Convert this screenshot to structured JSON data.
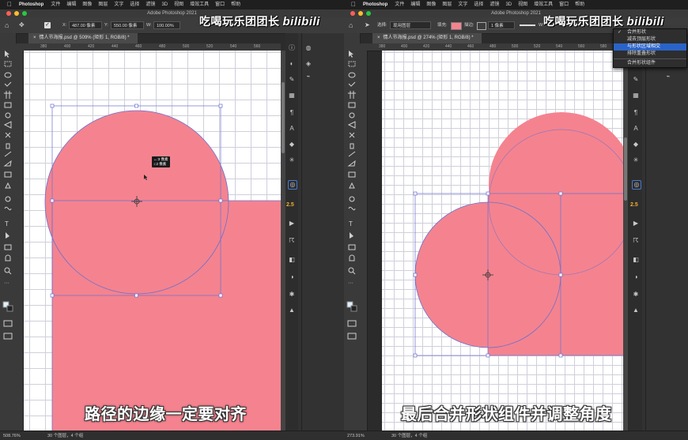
{
  "menubar": {
    "app": "Photoshop",
    "items": [
      "文件",
      "编辑",
      "图像",
      "图层",
      "文字",
      "选择",
      "滤镜",
      "3D",
      "视图",
      "增效工具",
      "窗口",
      "帮助"
    ]
  },
  "window_title": "Adobe Photoshop 2021",
  "watermark": {
    "text": "吃喝玩乐团团长",
    "brand": "bilibili"
  },
  "left": {
    "options": {
      "x_label": "X:",
      "x_value": "487.00 像素",
      "y_label": "Y:",
      "y_value": "550.00 像素",
      "w_label": "W:",
      "w_value": "100.00%"
    },
    "doc_tab": "情人节海报.psd @ 509% (矩形 1, RGB/8) *",
    "ruler_labels": [
      "380",
      "400",
      "420",
      "440",
      "460",
      "480",
      "500",
      "520",
      "540",
      "560"
    ],
    "tooltip": [
      "↔:3 像素",
      "↕:2 像素"
    ],
    "status": "508.76%",
    "status_info": "30 个图层，4 个组",
    "subtitle": "路径的边缘一定要对齐"
  },
  "right": {
    "options": {
      "select_label": "选择:",
      "select_value": "现用图层",
      "fill_label": "填充:",
      "stroke_label": "描边:",
      "stroke_value": "1 像素",
      "w_label": "W:"
    },
    "doc_tab": "情人节海报.psd @ 274% (矩形 1, RGB/8) *",
    "ruler_labels": [
      "380",
      "400",
      "420",
      "440",
      "460",
      "480",
      "500",
      "520",
      "540",
      "560",
      "580",
      "600"
    ],
    "status": "273.91%",
    "status_info": "30 个图层，4 个组",
    "subtitle": "最后合并形状组件并调整角度",
    "dropdown": {
      "items": [
        "合并形状",
        "减去顶层形状",
        "与形状区域相交",
        "排除重叠形状"
      ],
      "checked": "合并形状",
      "selected": "与形状区域相交",
      "footer": "合并形状组件"
    }
  },
  "panel_value": "2.5",
  "colors": {
    "shape": "#f4838f",
    "path": "#6b6fcf",
    "grid": "#cfd0da"
  }
}
